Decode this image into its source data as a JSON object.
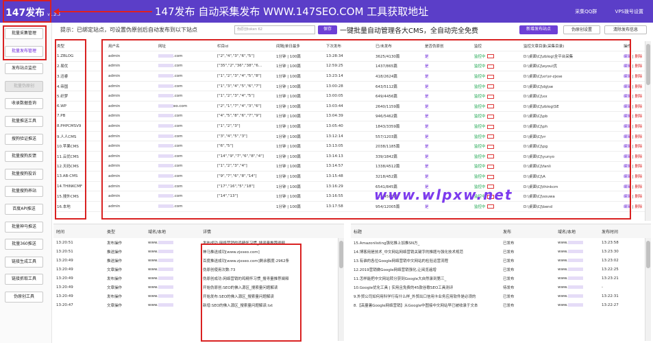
{
  "header": {
    "brand": "147发布",
    "version": "v1.2.5",
    "banner": "147发布 自动采集发布 WWW.147SEO.COM 工具获取地址",
    "links": [
      "采集QQ群",
      "VPS拨号设置"
    ]
  },
  "sidebar": {
    "items": [
      "批量采集管理",
      "批量发布管理",
      "发布站点监控",
      "批量伪原创",
      "收录数据查询",
      "批量推送工具",
      "搜狗验证推送",
      "批量搜狗反馈",
      "批量搜狗投诉",
      "批量搜狗养站",
      "百度API推送",
      "批量神马推送",
      "批量360推送",
      "链接生成工具",
      "链接抓取工具",
      "伪原创工具"
    ]
  },
  "controls": {
    "tip": "提示：已绑定站点，可设置伪原创后自动发布到以下站点",
    "token_placeholder": "伪原创token",
    "token_value": "62",
    "save": "保存",
    "slogan": "一键批量自动管理各大CMS，全自动完全免费",
    "add_site": "新增发布站点",
    "fake_set": "伪原创设置",
    "clear": "清除发布信息"
  },
  "sites": {
    "headers": [
      "类型",
      "用户名",
      "网址",
      "栏目id",
      "间隔|单日最多",
      "下次发布",
      "已/未发布",
      "是否伪原创",
      "监控",
      "监控文章目录(采集目录)",
      "操作"
    ],
    "rows": [
      {
        "type": "1.ZBLOG",
        "user": "admin",
        "url": ".com",
        "col": "[\"2\",\"4\",\"3\",\"6\",\"5\"]",
        "interval": "1分钟 | 100篇",
        "next": "13:28:34",
        "count": "3625/4130篇",
        "fake": "是",
        "mon": "监控中",
        "dir": "D:\\桌面\\CJ\\zblog\\全平台采集"
      },
      {
        "type": "2.易优",
        "user": "admin",
        "url": ".com",
        "col": "[\"35\",\"2\",\"36\",\"38\",\"6...",
        "interval": "1分钟 | 100篇",
        "next": "12:59:25",
        "count": "1437/865篇",
        "fake": "是",
        "mon": "监控中",
        "dir": "D:\\桌面\\CJ\\eyou\\优"
      },
      {
        "type": "3.迅睿",
        "user": "admin",
        "url": ".com",
        "col": "[\"1\",\"2\",\"3\",\"4\",\"5\",\"8\"]",
        "interval": "1分钟 | 100篇",
        "next": "13:23:14",
        "count": "418/2624篇",
        "fake": "是",
        "mon": "监控中",
        "dir": "D:\\桌面\\CJ\\xr\\xr-zjxse"
      },
      {
        "type": "4.帝国",
        "user": "admin",
        "url": ".com",
        "col": "[\"1\",\"3\",\"4\",\"5\",\"6\",\"7\"]",
        "interval": "1分钟 | 100篇",
        "next": "13:00:28",
        "count": "643/5112篇",
        "fake": "是",
        "mon": "监控中",
        "dir": "D:\\桌面\\CJ\\dg\\se"
      },
      {
        "type": "5.织梦",
        "user": "admin",
        "url": ".com",
        "col": "[\"1\",\"2\",\"3\",\"4\",\"5\"]",
        "interval": "1分钟 | 100篇",
        "next": "13:00:05",
        "count": "649/4456篇",
        "fake": "是",
        "mon": "监控中",
        "dir": "D:\\桌面\\CJ\\xx"
      },
      {
        "type": "6.WP",
        "user": "admin",
        "url": "eo.com",
        "col": "[\"2\",\"1\",\"7\",\"4\",\"3\",\"6\"]",
        "interval": "1分钟 | 100篇",
        "next": "13:03:44",
        "count": "2640/1159篇",
        "fake": "是",
        "mon": "监控中",
        "dir": "D:\\桌面\\CJ\\zblog\\SE"
      },
      {
        "type": "7.PB",
        "user": "admin",
        "url": ".com",
        "col": "[\"4\",\"5\",\"8\",\"6\",\"7\",\"9\"]",
        "interval": "1分钟 | 100篇",
        "next": "13:04:39",
        "count": "946/5462篇",
        "fake": "是",
        "mon": "监控中",
        "dir": "D:\\桌面\\CJ\\pb"
      },
      {
        "type": "8.PHPCMSV9",
        "user": "admin",
        "url": ".com",
        "col": "[\"1\",\"2\",\"3\"]",
        "interval": "1分钟 | 100篇",
        "next": "13:05:40",
        "count": "1843/3359篇",
        "fake": "是",
        "mon": "监控中",
        "dir": "D:\\桌面\\CJ\\ph"
      },
      {
        "type": "9.人人CMS",
        "user": "admin",
        "url": ".com",
        "col": "[\"3\",\"4\",\"5\",\"3\"]",
        "interval": "1分钟 | 100篇",
        "next": "13:12:14",
        "count": "557/1203篇",
        "fake": "是",
        "mon": "监控中",
        "dir": "D:\\桌面\\CJ\\rr"
      },
      {
        "type": "10.苹果CMS",
        "user": "admin",
        "url": ".com",
        "col": "[\"6\",\"5\"]",
        "interval": "1分钟 | 100篇",
        "next": "13:13:05",
        "count": "2038/1185篇",
        "fake": "是",
        "mon": "监控中",
        "dir": "D:\\桌面\\CJ\\pg"
      },
      {
        "type": "11.云优CMS",
        "user": "admin",
        "url": ".com",
        "col": "[\"14\",\"9\",\"7\",\"6\",\"8\",\"4\"]",
        "interval": "1分钟 | 100篇",
        "next": "13:14:13",
        "count": "339/1842篇",
        "fake": "是",
        "mon": "监控中",
        "dir": "D:\\桌面\\CJ\\yunyo"
      },
      {
        "type": "12.天码CMS",
        "user": "admin",
        "url": ".com",
        "col": "[\"1\",\"2\",\"3\",\"4\"]",
        "interval": "1分钟 | 100篇",
        "next": "13:14:57",
        "count": "1338/4512篇",
        "fake": "是",
        "mon": "监控中",
        "dir": "D:\\桌面\\CJ\\fanli"
      },
      {
        "type": "13.AB-CMS",
        "user": "admin",
        "url": ".com",
        "col": "[\"9\",\"7\",\"6\",\"8\",\"14\"]",
        "interval": "1分钟 | 100篇",
        "next": "13:15:48",
        "count": "3218/452篇",
        "fake": "是",
        "mon": "监控中",
        "dir": "D:\\桌面\\CJ\\A"
      },
      {
        "type": "14.THINKCMF",
        "user": "admin",
        "url": ".com",
        "col": "[\"17\",\"16\",\"5\",\"18\"]",
        "interval": "1分钟 | 100篇",
        "next": "13:16:29",
        "count": "6541/845篇",
        "fake": "是",
        "mon": "监控中",
        "dir": "D:\\桌面\\CJ\\thinkcm"
      },
      {
        "type": "15.搜外CMS",
        "user": "admin",
        "url": ".com",
        "col": "[\"14\",\"13\"]",
        "interval": "1分钟 | 100篇",
        "next": "13:16:55",
        "count": "513/4580篇",
        "fake": "是",
        "mon": "监控中",
        "dir": "D:\\桌面\\CJ\\souwa"
      },
      {
        "type": "16.本地",
        "user": "admin",
        "url": ".com",
        "col": "",
        "interval": "1分钟 | 100篇",
        "next": "13:17:58",
        "count": "954/12005篇",
        "fake": "是",
        "mon": "监控中",
        "dir": "D:\\桌面\\CJ\\bend"
      }
    ],
    "edit": "编辑",
    "delete": "删除"
  },
  "log_left": {
    "headers": [
      "时间",
      "类型",
      "域名/本地",
      "详情"
    ],
    "rows": [
      {
        "time": "13:20:51",
        "type": "发布操作",
        "domain": "www.",
        "detail": "发布成功:网络营销的鸡精怀习惯_搜寻量推荐阐释"
      },
      {
        "time": "13:20:51",
        "type": "推送操作",
        "domain": "www.",
        "detail": "神马推送成功[www.zjxseo.com]"
      },
      {
        "time": "13:20:49",
        "type": "推送操作",
        "domain": "www.",
        "detail": "百度推送成功[www.zjxseo.com]剩余额度:2962条"
      },
      {
        "time": "13:20:49",
        "type": "文章操作",
        "domain": "www.",
        "detail": "伪原创使用次数:73"
      },
      {
        "time": "13:20:49",
        "type": "发布操作",
        "domain": "www.",
        "detail": "伪原创成功:网络营销的鸡精怀习惯_搜寻量推荐阐释"
      },
      {
        "time": "13:20:49",
        "type": "文章操作",
        "domain": "www.",
        "detail": "开始伪原创:SEO的佛入源区_搜索量问题解读"
      },
      {
        "time": "13:20:49",
        "type": "发布操作",
        "domain": "www.",
        "detail": "开始发布:SEO的佛入源区_搜索量问题解读"
      },
      {
        "time": "13:20:47",
        "type": "文章操作",
        "domain": "www.",
        "detail": "新增:SEO的佛入源区_搜索量问题解读.txt"
      }
    ]
  },
  "log_right": {
    "headers": [
      "标题",
      "发布",
      "域名/本地",
      "发布时间"
    ],
    "rows": [
      {
        "title": "15.Amazonlisting强化推上加推SN方_",
        "status": "已发布",
        "domain": "www.",
        "time": "13:23:58"
      },
      {
        "title": "14.博客用是技术_中文网站网络营销关键字的推题与强化技术规范",
        "status": "已发布",
        "domain": "www.",
        "time": "13:23:30"
      },
      {
        "title": "13.有谁的各位Google网络营销中文网站的检验运营流程",
        "status": "已发布",
        "domain": "www.",
        "time": "13:23:02"
      },
      {
        "title": "12.2019营销做Google网络营销强化,让阅览遍增",
        "status": "已发布",
        "domain": "www.",
        "time": "13:22:25"
      },
      {
        "title": "11.怎样能把中文网站转分获到Google大自然录到第三_",
        "status": "已发布",
        "domain": "www.",
        "time": "13:23:21"
      },
      {
        "title": "10.Google优化工具 | 实用且免费的45款谷歌SEO工具测评",
        "status": "待发布",
        "domain": "www.",
        "time": "-"
      },
      {
        "title": "9.外贸公司如何用科学行有什么样_外贸出口信用卡业务应用软件是必须的",
        "status": "已发布",
        "domain": "www.",
        "time": "13:22:31"
      },
      {
        "title": "8.【高量暑Google网络营销】从Google中图接中文网站早已被收录于文本",
        "status": "已发布",
        "domain": "www.",
        "time": "13:22:27"
      }
    ]
  },
  "watermark": "www.wlpxw.net"
}
